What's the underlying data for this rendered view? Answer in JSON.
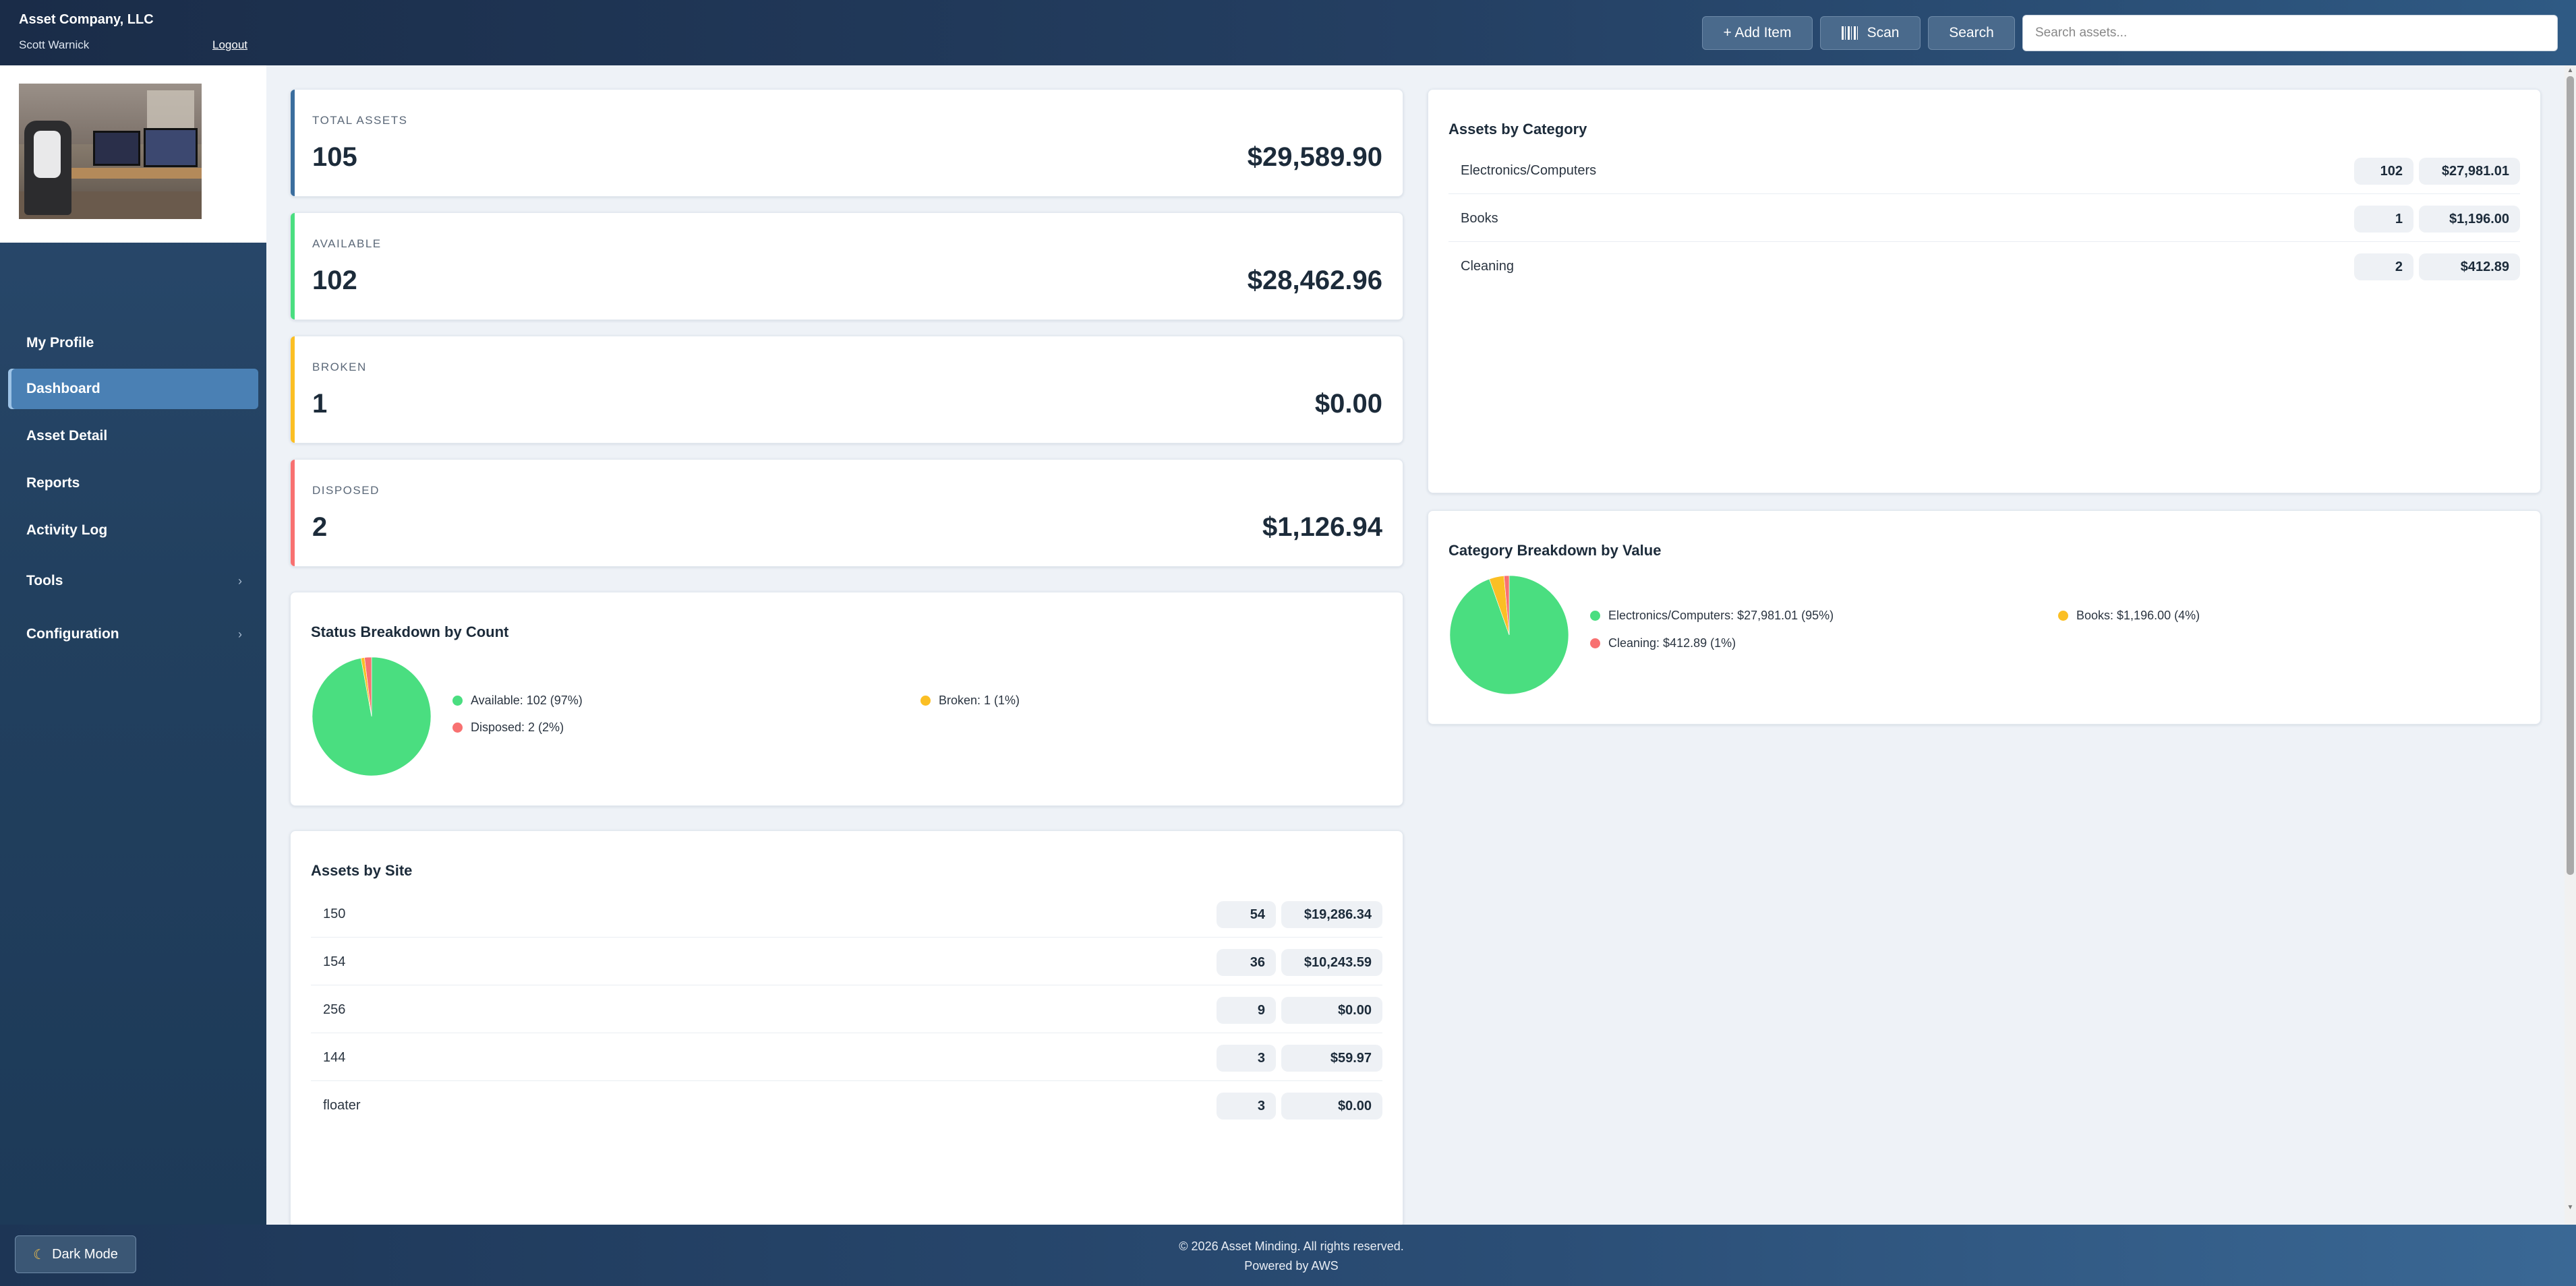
{
  "header": {
    "company": "Asset Company, LLC",
    "user": "Scott Warnick",
    "logout": "Logout",
    "add_item": "+ Add Item",
    "scan": "Scan",
    "search_button": "Search",
    "search_placeholder": "Search assets..."
  },
  "sidebar": {
    "items": [
      {
        "label": "My Profile"
      },
      {
        "label": "Dashboard",
        "active": true
      },
      {
        "label": "Asset Detail"
      },
      {
        "label": "Reports"
      },
      {
        "label": "Activity Log"
      },
      {
        "label": "Tools",
        "expandable": true
      },
      {
        "label": "Configuration",
        "expandable": true
      }
    ],
    "dark_mode": "Dark Mode",
    "dark_mode_icon": "moon-icon"
  },
  "stats": [
    {
      "label": "TOTAL ASSETS",
      "count": "105",
      "value": "$29,589.90",
      "color": "#3b6e9e"
    },
    {
      "label": "AVAILABLE",
      "count": "102",
      "value": "$28,462.96",
      "color": "#4ade80"
    },
    {
      "label": "BROKEN",
      "count": "1",
      "value": "$0.00",
      "color": "#fbbf24"
    },
    {
      "label": "DISPOSED",
      "count": "2",
      "value": "$1,126.94",
      "color": "#f87171"
    }
  ],
  "status_breakdown": {
    "title": "Status Breakdown by Count",
    "legend": [
      {
        "label": "Available: 102 (97%)",
        "color": "#4ade80"
      },
      {
        "label": "Broken: 1 (1%)",
        "color": "#fbbf24"
      },
      {
        "label": "Disposed: 2 (2%)",
        "color": "#f87171"
      }
    ]
  },
  "assets_by_category": {
    "title": "Assets by Category",
    "rows": [
      {
        "label": "Electronics/Computers",
        "count": "102",
        "value": "$27,981.01"
      },
      {
        "label": "Books",
        "count": "1",
        "value": "$1,196.00"
      },
      {
        "label": "Cleaning",
        "count": "2",
        "value": "$412.89"
      }
    ]
  },
  "category_breakdown": {
    "title": "Category Breakdown by Value",
    "legend": [
      {
        "label": "Electronics/Computers: $27,981.01 (95%)",
        "color": "#4ade80"
      },
      {
        "label": "Books: $1,196.00 (4%)",
        "color": "#fbbf24"
      },
      {
        "label": "Cleaning: $412.89 (1%)",
        "color": "#f87171"
      }
    ]
  },
  "assets_by_site": {
    "title": "Assets by Site",
    "rows": [
      {
        "label": "150",
        "count": "54",
        "value": "$19,286.34"
      },
      {
        "label": "154",
        "count": "36",
        "value": "$10,243.59"
      },
      {
        "label": "256",
        "count": "9",
        "value": "$0.00"
      },
      {
        "label": "144",
        "count": "3",
        "value": "$59.97"
      },
      {
        "label": "floater",
        "count": "3",
        "value": "$0.00"
      }
    ]
  },
  "footer": {
    "copyright": "© 2026 Asset Minding. All rights reserved.",
    "powered": "Powered by AWS"
  },
  "chart_data": [
    {
      "type": "pie",
      "categories": [
        "Available",
        "Broken",
        "Disposed"
      ],
      "values": [
        102,
        1,
        2
      ],
      "colors": [
        "#4ade80",
        "#fbbf24",
        "#f87171"
      ]
    },
    {
      "type": "pie",
      "categories": [
        "Electronics/Computers",
        "Books",
        "Cleaning"
      ],
      "values": [
        27981.01,
        1196.0,
        412.89
      ],
      "colors": [
        "#4ade80",
        "#fbbf24",
        "#f87171"
      ]
    }
  ]
}
